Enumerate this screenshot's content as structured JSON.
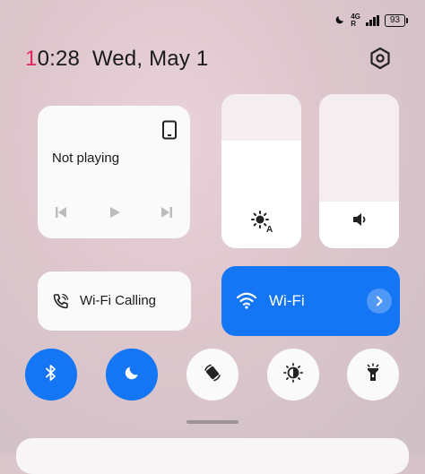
{
  "status_bar": {
    "network_line1": "4G",
    "network_line2": "R",
    "battery": "93",
    "icons": [
      "moon-icon",
      "signal-icon",
      "battery-icon"
    ]
  },
  "header": {
    "time_first_char": "1",
    "time_rest": "0:28",
    "date": "Wed, May 1",
    "settings_icon": "settings-icon"
  },
  "media": {
    "status": "Not playing",
    "device_icon": "phone-icon",
    "controls": [
      "previous-icon",
      "play-icon",
      "next-icon"
    ]
  },
  "sliders": {
    "brightness": {
      "icon": "auto-brightness-icon",
      "level": 0.7
    },
    "volume": {
      "icon": "volume-icon",
      "level": 0.3
    }
  },
  "tiles": {
    "wifi_calling": {
      "label": "Wi-Fi Calling",
      "icon": "wifi-calling-icon"
    },
    "wifi": {
      "label": "Wi-Fi",
      "icon": "wifi-icon",
      "active": true
    }
  },
  "toggles": [
    {
      "icon": "bluetooth-icon",
      "active": true
    },
    {
      "icon": "moon-icon",
      "active": true
    },
    {
      "icon": "auto-rotate-icon",
      "active": false
    },
    {
      "icon": "dark-mode-icon",
      "active": false
    },
    {
      "icon": "flashlight-icon",
      "active": false
    }
  ],
  "colors": {
    "accent": "#1476f5",
    "time_highlight": "#e2245c",
    "card": "#fafafa"
  }
}
